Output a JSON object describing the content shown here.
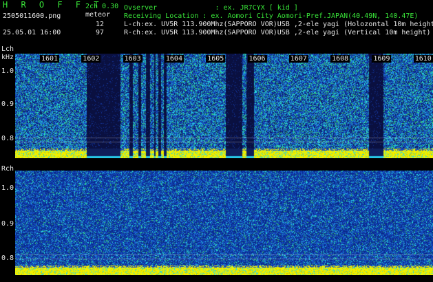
{
  "header": {
    "app_title": "H R O F F T",
    "version": "2ch 0.30",
    "meteor_label": "meteor",
    "filename": "2505011600.png",
    "datetime": "25.05.01 16:00",
    "lch_count": "12",
    "rch_count": "97",
    "observer": "Ovserver              : ex. JR7CYX [ kid ]",
    "location": "Receiving Location : ex. Aomori City Aomori-Pref.JAPAN(40.49N, 140.47E)",
    "lch_info": "L-ch:ex. UV5R 113.900Mhz(SAPPORO VOR)USB ,2-ele yagi (Holozontal 10m height)",
    "rch_info": "R-ch:ex. UV5R 113.900Mhz(SAPPORO VOR)USB ,2-ele yagi (Vertical 10m height)"
  },
  "top_panel": {
    "channel_label": "Lch",
    "unit_label": "kHz",
    "y_ticks": [
      "1.0",
      "0.9",
      "0.8"
    ],
    "time_marks": [
      "1601",
      "1602",
      "1603",
      "1604",
      "1605",
      "1606",
      "1607",
      "1608",
      "1609",
      "1610"
    ]
  },
  "bottom_panel": {
    "channel_label": "Rch",
    "y_ticks": [
      "1.0",
      "0.9",
      "0.8"
    ]
  },
  "colors": {
    "text_green": "#39e639",
    "text_white": "#e8e8e8",
    "noise_dark": "#0a2a8a",
    "noise_blue": "#1e6fd9",
    "noise_cyan": "#27d8e0",
    "noise_green": "#35c06a",
    "signal_yellow": "#f0f000",
    "gap_navy": "#0a1040"
  }
}
